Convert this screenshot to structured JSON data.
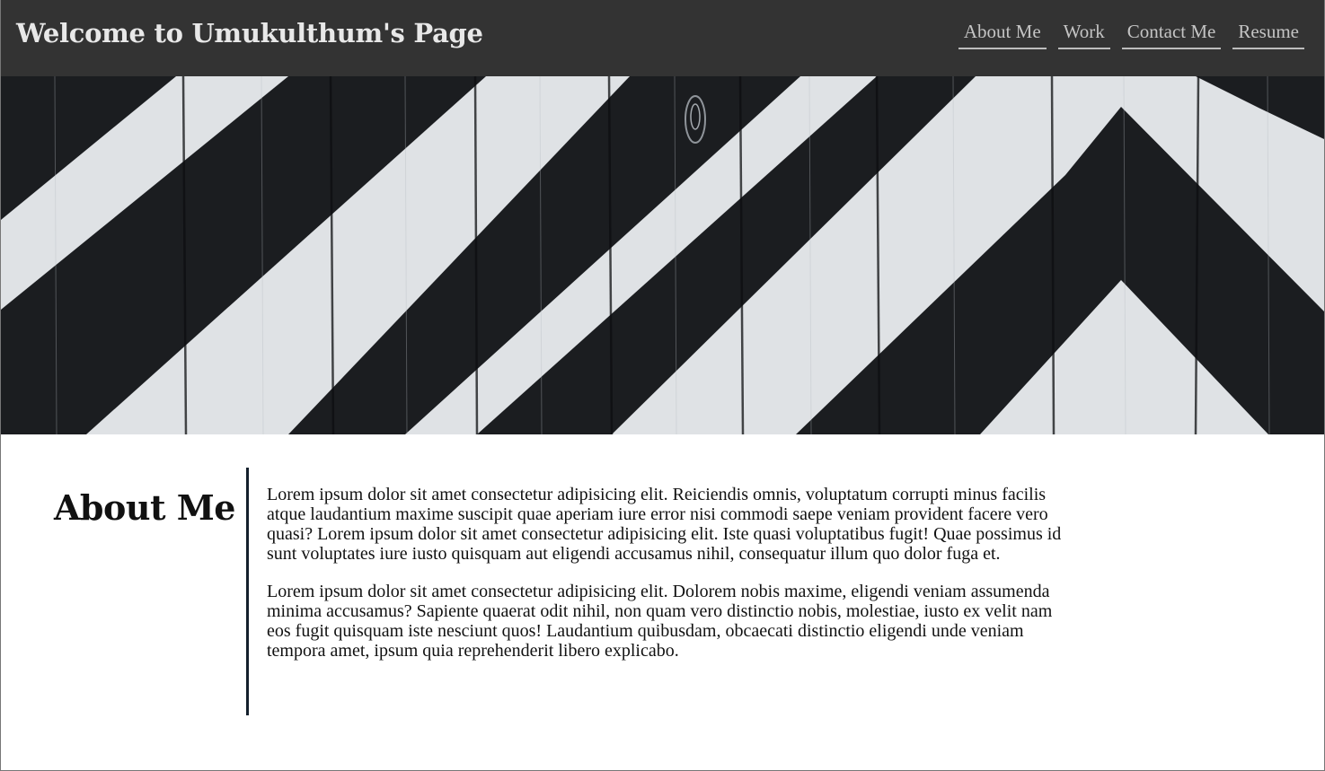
{
  "header": {
    "title": "Welcome to Umukulthum's Page",
    "nav": [
      {
        "label": "About Me"
      },
      {
        "label": "Work"
      },
      {
        "label": "Contact Me"
      },
      {
        "label": "Resume"
      }
    ]
  },
  "hero": {
    "image": "black-and-white-chevron-wood-planks",
    "colors": {
      "dark": "#1b1d20",
      "light": "#dfe2e5"
    }
  },
  "about": {
    "heading": "About Me",
    "paragraphs": [
      "Lorem ipsum dolor sit amet consectetur adipisicing elit. Reiciendis omnis, voluptatum corrupti minus facilis atque laudantium maxime suscipit quae aperiam iure error nisi commodi saepe veniam provident facere vero quasi? Lorem ipsum dolor sit amet consectetur adipisicing elit. Iste quasi voluptatibus fugit! Quae possimus id sunt voluptates iure iusto quisquam aut eligendi accusamus nihil, consequatur illum quo dolor fuga et.",
      "Lorem ipsum dolor sit amet consectetur adipisicing elit. Dolorem nobis maxime, eligendi veniam assumenda minima accusamus? Sapiente quaerat odit nihil, non quam vero distinctio nobis, molestiae, iusto ex velit nam eos fugit quisquam iste nesciunt quos! Laudantium quibusdam, obcaecati distinctio eligendi unde veniam tempora amet, ipsum quia reprehenderit libero explicabo."
    ]
  },
  "colors": {
    "header_bg": "#333333",
    "title_text": "#e8e8e8",
    "nav_text": "#c4c4c4",
    "divider": "#14202c"
  }
}
